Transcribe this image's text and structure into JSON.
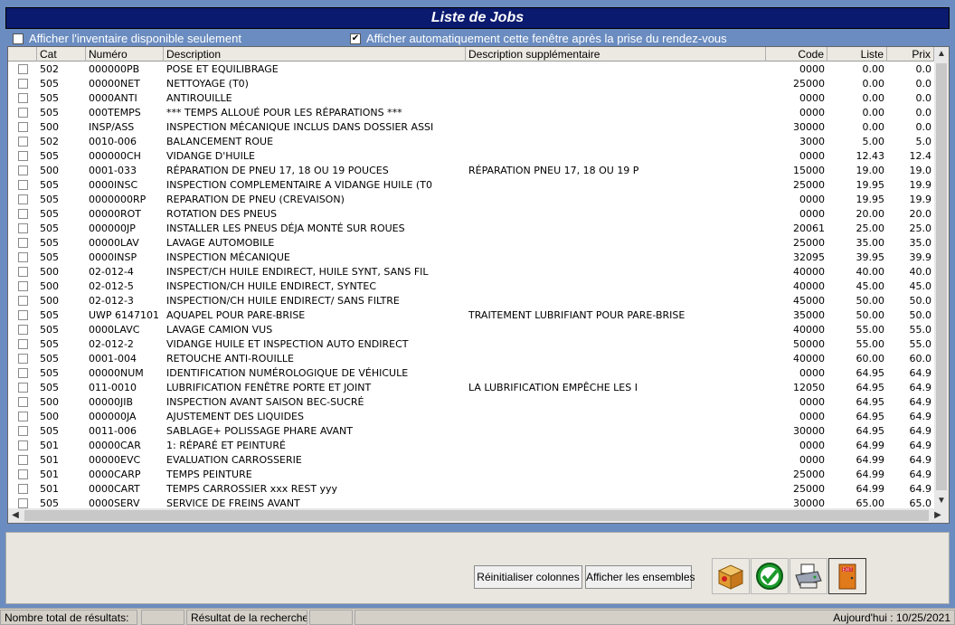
{
  "window": {
    "title": "Liste de Jobs"
  },
  "options": {
    "inventory_only": {
      "label": "Afficher l'inventaire disponible seulement",
      "checked": false
    },
    "auto_show": {
      "label": "Afficher automatiquement cette fenêtre après la prise du rendez-vous",
      "checked": true
    }
  },
  "grid": {
    "headers": {
      "cat": "Cat",
      "numero": "Numéro",
      "description": "Description",
      "desc_supp": "Description supplémentaire",
      "code": "Code",
      "liste": "Liste",
      "prix": "Prix"
    },
    "rows": [
      {
        "cat": "502",
        "numero": "000000PB",
        "description": "POSE ET EQUILIBRAGE",
        "desc_supp": "",
        "code": "0000",
        "liste": "0.00",
        "prix": "0.0"
      },
      {
        "cat": "505",
        "numero": "00000NET",
        "description": "NETTOYAGE (T0)",
        "desc_supp": "",
        "code": "25000",
        "liste": "0.00",
        "prix": "0.0"
      },
      {
        "cat": "505",
        "numero": "0000ANTI",
        "description": "ANTIROUILLE",
        "desc_supp": "",
        "code": "0000",
        "liste": "0.00",
        "prix": "0.0"
      },
      {
        "cat": "505",
        "numero": "000TEMPS",
        "description": "*** TEMPS ALLOUÉ POUR LES RÉPARATIONS ***",
        "desc_supp": "",
        "code": "0000",
        "liste": "0.00",
        "prix": "0.0"
      },
      {
        "cat": "500",
        "numero": "INSP/ASS",
        "description": "INSPECTION MÉCANIQUE INCLUS DANS DOSSIER ASSI",
        "desc_supp": "",
        "code": "30000",
        "liste": "0.00",
        "prix": "0.0"
      },
      {
        "cat": "502",
        "numero": "0010-006",
        "description": "BALANCEMENT ROUE",
        "desc_supp": "",
        "code": "3000",
        "liste": "5.00",
        "prix": "5.0"
      },
      {
        "cat": "505",
        "numero": "000000CH",
        "description": "VIDANGE D'HUILE",
        "desc_supp": "",
        "code": "0000",
        "liste": "12.43",
        "prix": "12.4"
      },
      {
        "cat": "500",
        "numero": "0001-033",
        "description": "RÉPARATION DE PNEU 17, 18 OU 19 POUCES",
        "desc_supp": "RÉPARATION PNEU 17, 18 OU 19 P",
        "code": "15000",
        "liste": "19.00",
        "prix": "19.0"
      },
      {
        "cat": "505",
        "numero": "0000INSC",
        "description": "INSPECTION COMPLEMENTAIRE A VIDANGE HUILE (T0",
        "desc_supp": "",
        "code": "25000",
        "liste": "19.95",
        "prix": "19.9"
      },
      {
        "cat": "505",
        "numero": "0000000RP",
        "description": "REPARATION DE PNEU (CREVAISON)",
        "desc_supp": "",
        "code": "0000",
        "liste": "19.95",
        "prix": "19.9"
      },
      {
        "cat": "505",
        "numero": "00000ROT",
        "description": "ROTATION DES PNEUS",
        "desc_supp": "",
        "code": "0000",
        "liste": "20.00",
        "prix": "20.0"
      },
      {
        "cat": "505",
        "numero": "000000JP",
        "description": "INSTALLER LES PNEUS DÉJA MONTÉ SUR ROUES",
        "desc_supp": "",
        "code": "20061",
        "liste": "25.00",
        "prix": "25.0"
      },
      {
        "cat": "505",
        "numero": "00000LAV",
        "description": "LAVAGE AUTOMOBILE",
        "desc_supp": "",
        "code": "25000",
        "liste": "35.00",
        "prix": "35.0"
      },
      {
        "cat": "505",
        "numero": "0000INSP",
        "description": "INSPECTION MÉCANIQUE",
        "desc_supp": "",
        "code": "32095",
        "liste": "39.95",
        "prix": "39.9"
      },
      {
        "cat": "500",
        "numero": "02-012-4",
        "description": "INSPECT/CH HUILE ENDIRECT, HUILE SYNT, SANS FIL",
        "desc_supp": "",
        "code": "40000",
        "liste": "40.00",
        "prix": "40.0"
      },
      {
        "cat": "500",
        "numero": "02-012-5",
        "description": "INSPECTION/CH HUILE ENDIRECT, SYNTEC",
        "desc_supp": "",
        "code": "40000",
        "liste": "45.00",
        "prix": "45.0"
      },
      {
        "cat": "500",
        "numero": "02-012-3",
        "description": "INSPECTION/CH HUILE ENDIRECT/ SANS FILTRE",
        "desc_supp": "",
        "code": "45000",
        "liste": "50.00",
        "prix": "50.0"
      },
      {
        "cat": "505",
        "numero": "UWP 6147101",
        "description": "AQUAPEL POUR PARE-BRISE",
        "desc_supp": "TRAITEMENT LUBRIFIANT POUR PARE-BRISE",
        "code": "35000",
        "liste": "50.00",
        "prix": "50.0"
      },
      {
        "cat": "505",
        "numero": "0000LAVC",
        "description": "LAVAGE CAMION VUS",
        "desc_supp": "",
        "code": "40000",
        "liste": "55.00",
        "prix": "55.0"
      },
      {
        "cat": "505",
        "numero": "02-012-2",
        "description": "VIDANGE HUILE ET INSPECTION AUTO ENDIRECT",
        "desc_supp": "",
        "code": "50000",
        "liste": "55.00",
        "prix": "55.0"
      },
      {
        "cat": "505",
        "numero": "0001-004",
        "description": "RETOUCHE ANTI-ROUILLE",
        "desc_supp": "",
        "code": "40000",
        "liste": "60.00",
        "prix": "60.0"
      },
      {
        "cat": "505",
        "numero": "00000NUM",
        "description": "IDENTIFICATION NUMÉROLOGIQUE DE VÉHICULE",
        "desc_supp": "",
        "code": "0000",
        "liste": "64.95",
        "prix": "64.9"
      },
      {
        "cat": "505",
        "numero": "011-0010",
        "description": "LUBRIFICATION FENÊTRE PORTE ET JOINT",
        "desc_supp": "LA LUBRIFICATION EMPÊCHE LES I",
        "code": "12050",
        "liste": "64.95",
        "prix": "64.9"
      },
      {
        "cat": "500",
        "numero": "00000JIB",
        "description": "INSPECTION AVANT SAISON BEC-SUCRÉ",
        "desc_supp": "",
        "code": "0000",
        "liste": "64.95",
        "prix": "64.9"
      },
      {
        "cat": "500",
        "numero": "000000JA",
        "description": "AJUSTEMENT DES LIQUIDES",
        "desc_supp": "",
        "code": "0000",
        "liste": "64.95",
        "prix": "64.9"
      },
      {
        "cat": "505",
        "numero": "0011-006",
        "description": "SABLAGE+ POLISSAGE PHARE AVANT",
        "desc_supp": "",
        "code": "30000",
        "liste": "64.95",
        "prix": "64.9"
      },
      {
        "cat": "501",
        "numero": "00000CAR",
        "description": "1: RÉPARÉ ET PEINTURÉ",
        "desc_supp": "",
        "code": "0000",
        "liste": "64.99",
        "prix": "64.9"
      },
      {
        "cat": "501",
        "numero": "00000EVC",
        "description": "EVALUATION CARROSSERIE",
        "desc_supp": "",
        "code": "0000",
        "liste": "64.99",
        "prix": "64.9"
      },
      {
        "cat": "501",
        "numero": "0000CARP",
        "description": "TEMPS PEINTURE",
        "desc_supp": "",
        "code": "25000",
        "liste": "64.99",
        "prix": "64.9"
      },
      {
        "cat": "501",
        "numero": "0000CART",
        "description": "TEMPS CARROSSIER xxx  REST yyy",
        "desc_supp": "",
        "code": "25000",
        "liste": "64.99",
        "prix": "64.9"
      },
      {
        "cat": "505",
        "numero": "0000SERV",
        "description": "SERVICE DE FREINS AVANT",
        "desc_supp": "",
        "code": "30000",
        "liste": "65.00",
        "prix": "65.0"
      }
    ]
  },
  "buttons": {
    "reset_columns": "Réinitialiser colonnes",
    "show_sets": "Afficher les ensembles"
  },
  "icons": {
    "package": "package-icon",
    "confirm": "confirm-check-icon",
    "print": "printer-icon",
    "exit": "exit-door-icon"
  },
  "exit_icon_text": "EXIT",
  "status": {
    "total_label": "Nombre total de résultats:",
    "total_value": "",
    "search_label": "Résultat de la recherche:",
    "search_value": "",
    "today": "Aujourd'hui : 10/25/2021"
  },
  "colors": {
    "title_bar": "#0a1a6e",
    "window_bg": "#6a8cc0",
    "confirm_green": "#1a9a2a",
    "exit_orange": "#e07a1a"
  }
}
